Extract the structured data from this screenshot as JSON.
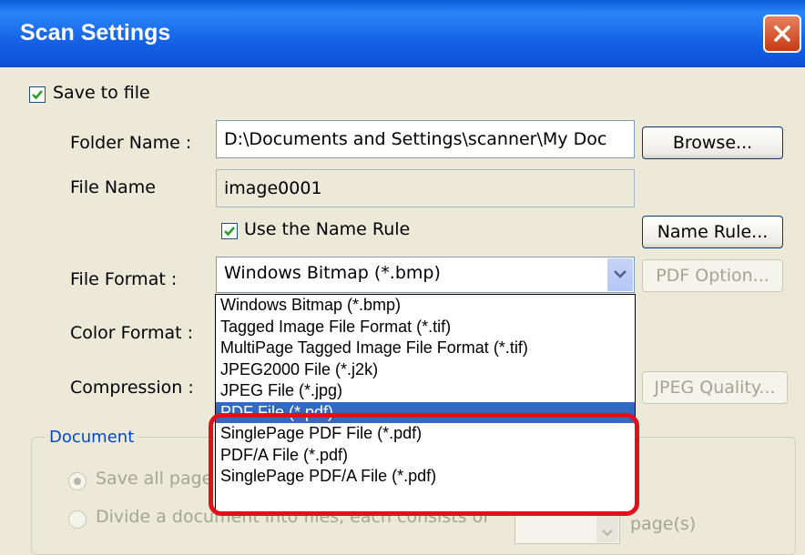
{
  "window": {
    "title": "Scan Settings"
  },
  "save_to_file": {
    "label": "Save to file",
    "checked": true
  },
  "folder": {
    "label": "Folder Name :",
    "value": "D:\\Documents and Settings\\scanner\\My Doc",
    "browse_label": "Browse..."
  },
  "file_name": {
    "label": "File Name",
    "value": "image0001"
  },
  "name_rule": {
    "checkbox_label": "Use the Name Rule",
    "checked": true,
    "button_label": "Name Rule..."
  },
  "file_format": {
    "label": "File Format :",
    "selected": "Windows Bitmap (*.bmp)",
    "pdf_option_label": "PDF Option...",
    "options": [
      "Windows Bitmap (*.bmp)",
      "Tagged Image File Format (*.tif)",
      "MultiPage Tagged Image File Format (*.tif)",
      "JPEG2000 File (*.j2k)",
      "JPEG File (*.jpg)",
      "PDF File (*.pdf)",
      "SinglePage PDF File (*.pdf)",
      "PDF/A File (*.pdf)",
      "SinglePage PDF/A File (*.pdf)"
    ],
    "highlighted_option": "PDF File (*.pdf)"
  },
  "color_format": {
    "label": "Color Format :"
  },
  "compression": {
    "label": "Compression :",
    "jpeg_quality_label": "JPEG Quality..."
  },
  "document": {
    "group_label": "Document",
    "save_all_label": "Save all page",
    "divide_label": "Divide a document into files, each consists of",
    "pages_suffix": "page(s)"
  },
  "colors": {
    "title_bar": "#0a5edb",
    "selection": "#316ac5",
    "highlight_ring": "#e0111a",
    "group_label": "#0046d5"
  }
}
